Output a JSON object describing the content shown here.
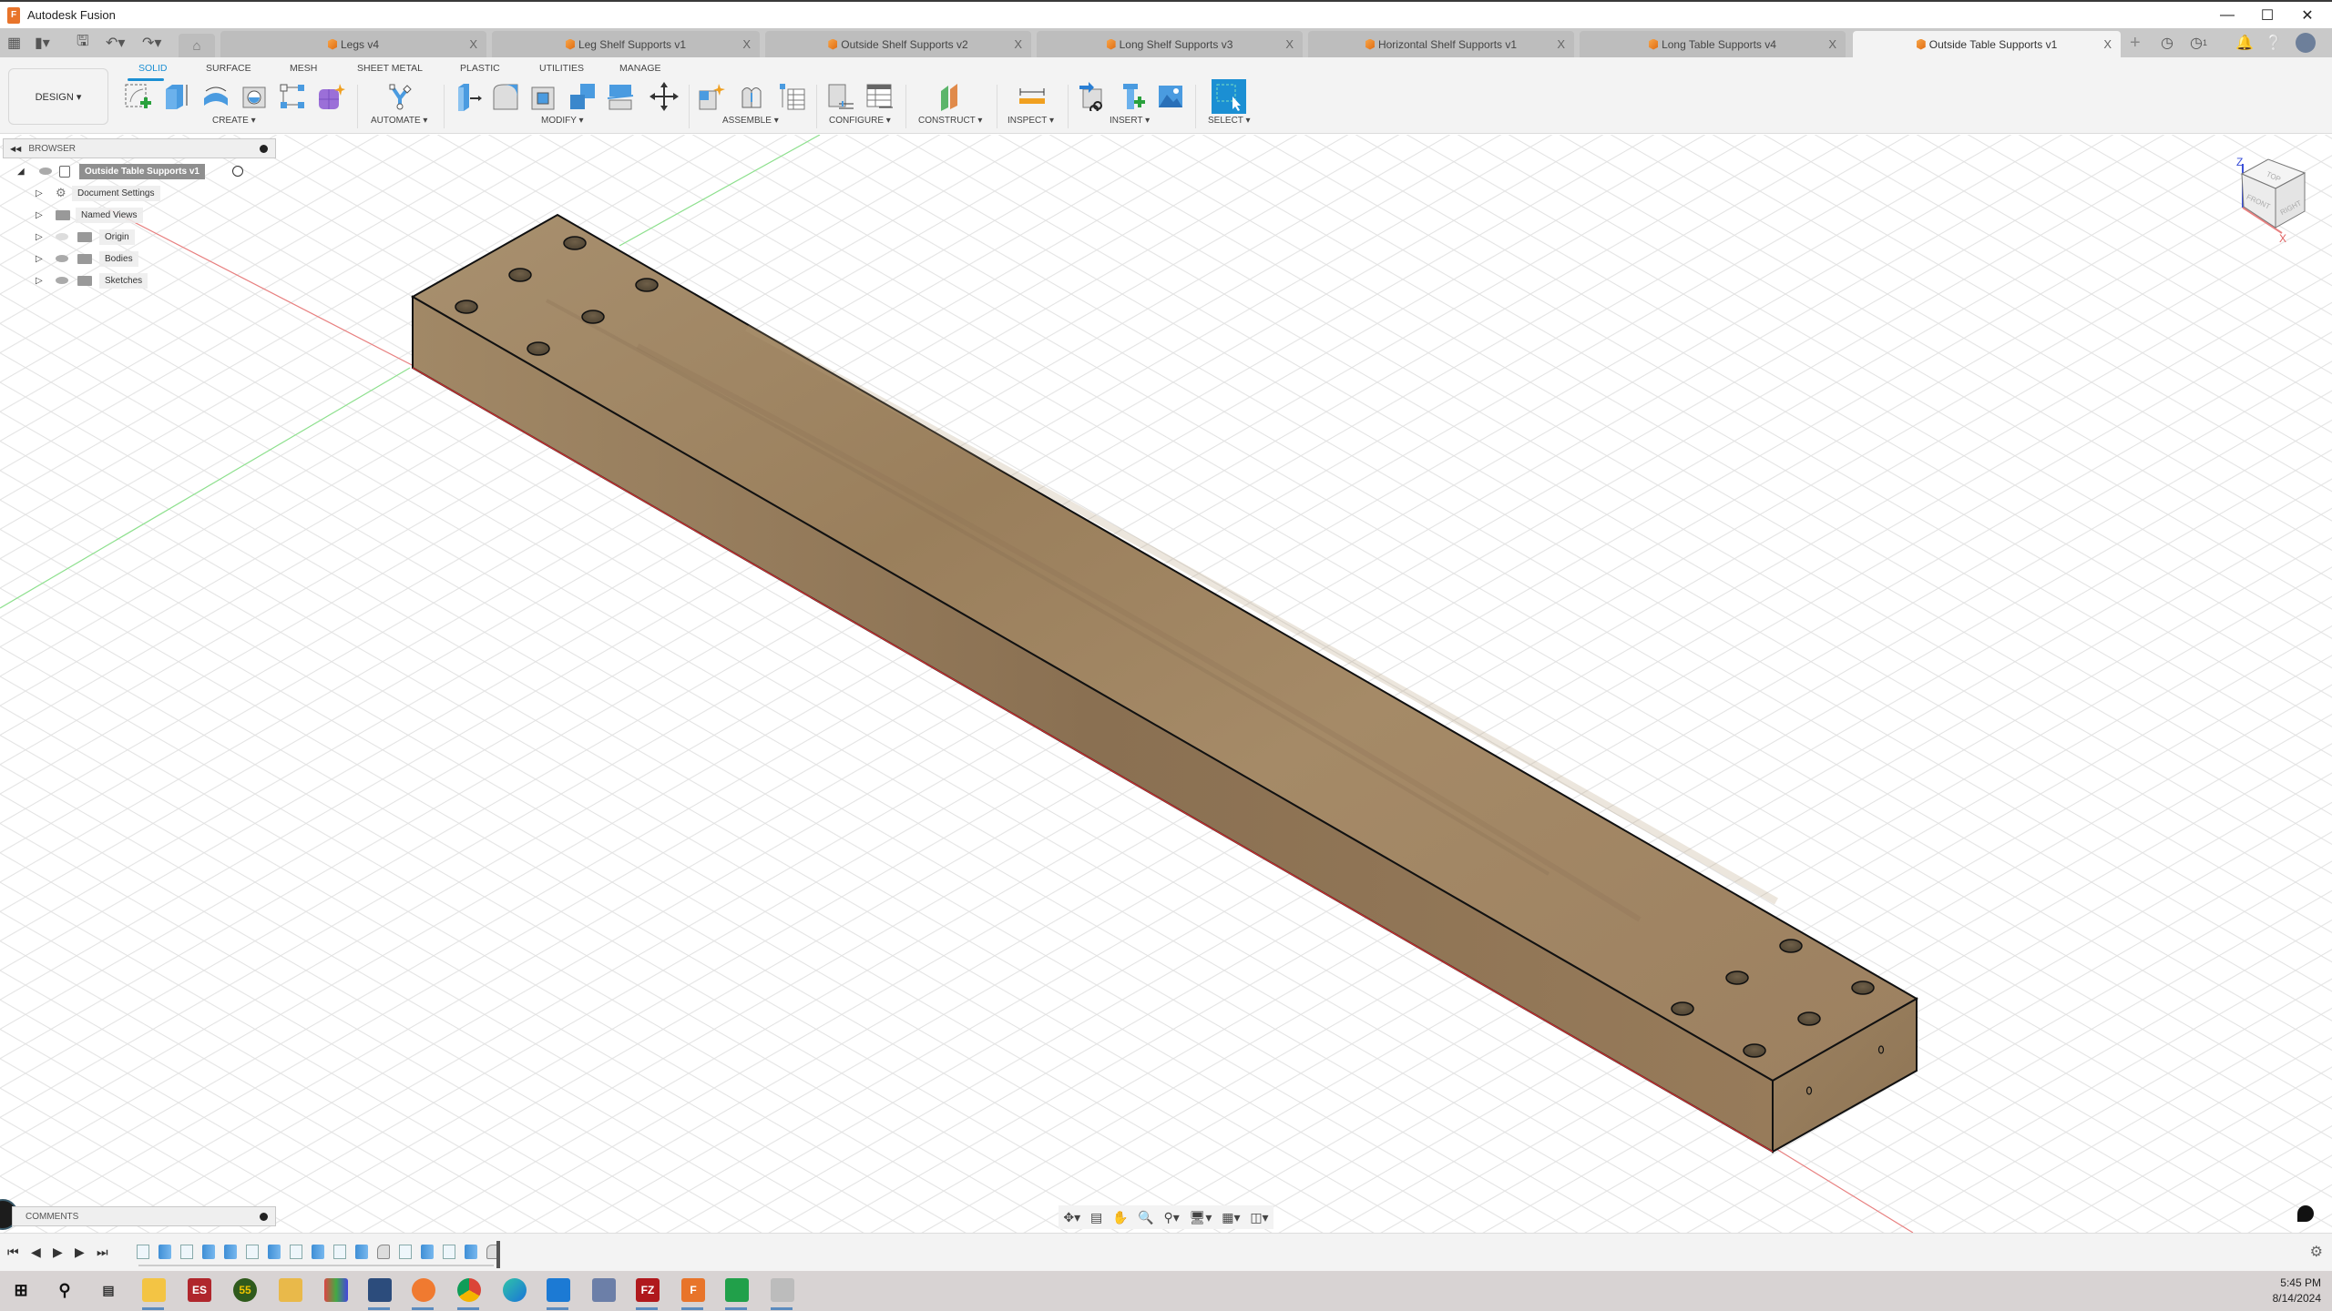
{
  "window": {
    "title": "Autodesk Fusion",
    "controls": [
      "minimize",
      "maximize",
      "close"
    ]
  },
  "quick_access": [
    "apps-grid-icon",
    "file-icon",
    "save-icon",
    "undo-icon",
    "redo-icon"
  ],
  "tabs": [
    {
      "label": "Legs v4",
      "active": false
    },
    {
      "label": "Leg Shelf Supports v1",
      "active": false
    },
    {
      "label": "Outside Shelf Supports v2",
      "active": false
    },
    {
      "label": "Long Shelf Supports v3",
      "active": false
    },
    {
      "label": "Horizontal Shelf Supports v1",
      "active": false
    },
    {
      "label": "Long Table Supports v4",
      "active": false
    },
    {
      "label": "Outside Table Supports v1",
      "active": true
    }
  ],
  "tab_close_glyph": "X",
  "header_right": {
    "new_tab": "+",
    "job_count": "1"
  },
  "ribbon": {
    "workspace": "DESIGN ▾",
    "tabs": [
      "SOLID",
      "SURFACE",
      "MESH",
      "SHEET METAL",
      "PLASTIC",
      "UTILITIES",
      "MANAGE"
    ],
    "active_tab": "SOLID",
    "groups": [
      {
        "label": "CREATE ▾",
        "tools": [
          "create-sketch",
          "extrude",
          "revolve",
          "hole",
          "pattern",
          "create-form"
        ]
      },
      {
        "label": "AUTOMATE ▾",
        "tools": [
          "automate"
        ]
      },
      {
        "label": "MODIFY ▾",
        "tools": [
          "press-pull",
          "fillet",
          "shell",
          "combine",
          "split-body",
          "move-copy"
        ]
      },
      {
        "label": "ASSEMBLE ▾",
        "tools": [
          "new-component",
          "joint",
          "bill-of-materials"
        ]
      },
      {
        "label": "CONFIGURE ▾",
        "tools": [
          "configure",
          "configuration-table"
        ]
      },
      {
        "label": "CONSTRUCT ▾",
        "tools": [
          "offset-plane"
        ]
      },
      {
        "label": "INSPECT ▾",
        "tools": [
          "measure"
        ]
      },
      {
        "label": "INSERT ▾",
        "tools": [
          "insert-derive",
          "insert-mcmaster",
          "insert-canvas"
        ]
      },
      {
        "label": "SELECT ▾",
        "tools": [
          "select"
        ]
      }
    ]
  },
  "browser": {
    "title": "BROWSER",
    "root": "Outside Table Supports v1",
    "items": [
      {
        "label": "Document Settings",
        "icon": "gear",
        "visible": null
      },
      {
        "label": "Named Views",
        "icon": "folder",
        "visible": null
      },
      {
        "label": "Origin",
        "icon": "folder",
        "visible": false
      },
      {
        "label": "Bodies",
        "icon": "folder",
        "visible": true
      },
      {
        "label": "Sketches",
        "icon": "folder",
        "visible": true
      }
    ]
  },
  "viewcube": {
    "faces": [
      "TOP",
      "FRONT",
      "RIGHT"
    ],
    "axes": [
      "Z",
      "X"
    ]
  },
  "comments": {
    "title": "COMMENTS"
  },
  "timeline": {
    "features": [
      "sketch",
      "extrude",
      "sketch",
      "extrude",
      "extrude",
      "sketch",
      "extrude",
      "sketch",
      "extrude",
      "sketch",
      "extrude",
      "fillet",
      "sketch",
      "extrude",
      "sketch",
      "extrude",
      "fillet"
    ]
  },
  "taskbar": {
    "apps": [
      "start",
      "search",
      "task-view",
      "file-explorer",
      "es",
      "55",
      "app-blue",
      "app-colorful",
      "virtualbox",
      "firefox",
      "chrome",
      "edge",
      "vscode",
      "network",
      "filezilla",
      "fusion",
      "sheets",
      "app-gray"
    ],
    "time": "5:45 PM",
    "date": "8/14/2024"
  },
  "colors": {
    "accent": "#1b8fd3",
    "wood_top": "#a08462",
    "wood_side": "#8f7556",
    "ribbon_bg": "#f3f3f3"
  }
}
